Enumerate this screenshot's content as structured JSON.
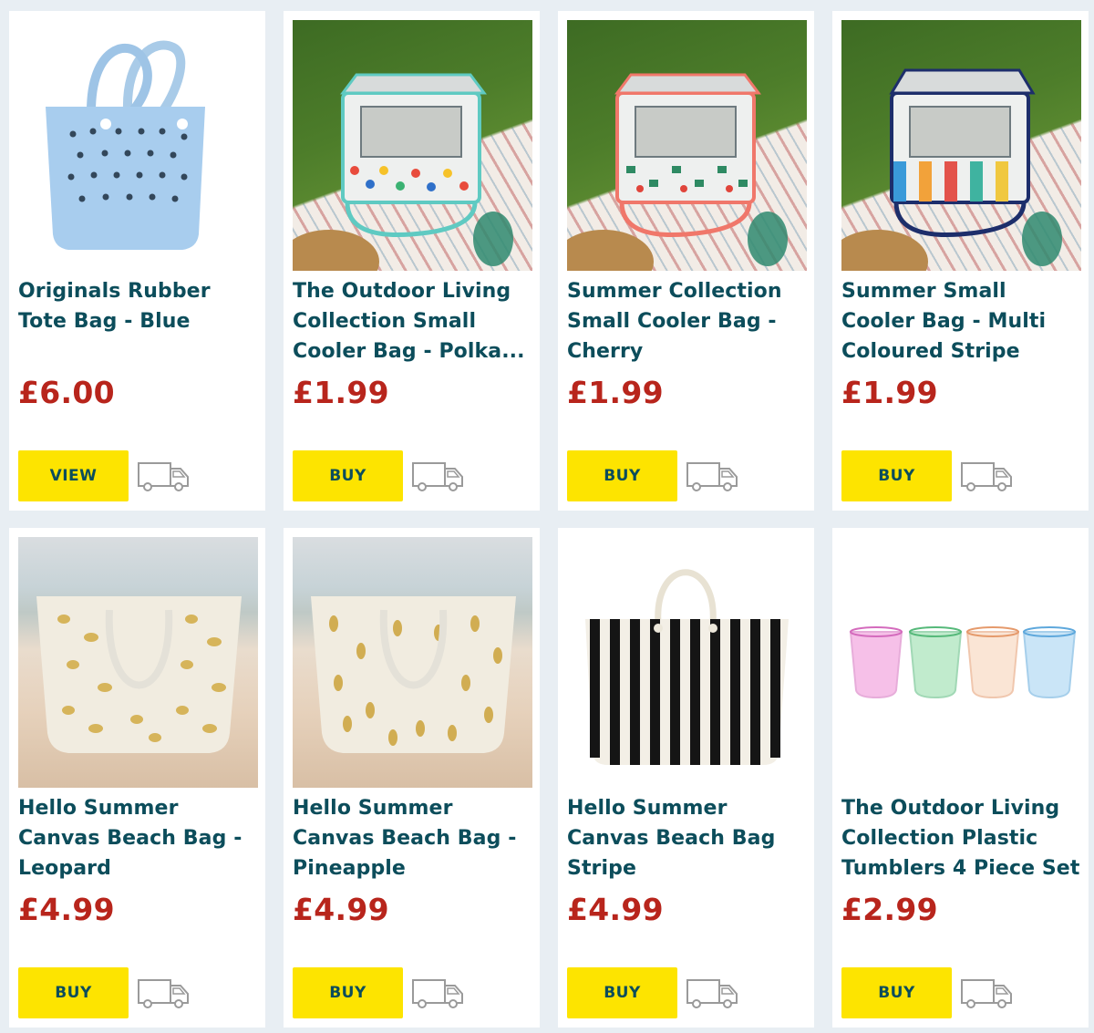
{
  "products": [
    {
      "title": "Originals Rubber Tote Bag - Blue",
      "price": "£6.00",
      "button": "VIEW",
      "image": "blue-rubber-tote-bag"
    },
    {
      "title": "The Outdoor Living Collection Small Cooler Bag - Polka...",
      "price": "£1.99",
      "button": "BUY",
      "image": "polka-cooler-bag"
    },
    {
      "title": "Summer Collection Small Cooler Bag - Cherry",
      "price": "£1.99",
      "button": "BUY",
      "image": "cherry-cooler-bag"
    },
    {
      "title": "Summer Small Cooler Bag - Multi Coloured Stripe",
      "price": "£1.99",
      "button": "BUY",
      "image": "stripe-cooler-bag"
    },
    {
      "title": "Hello Summer Canvas Beach Bag - Leopard",
      "price": "£4.99",
      "button": "BUY",
      "image": "leopard-beach-bag"
    },
    {
      "title": "Hello Summer Canvas Beach Bag - Pineapple",
      "price": "£4.99",
      "button": "BUY",
      "image": "pineapple-beach-bag"
    },
    {
      "title": "Hello Summer Canvas Beach Bag Stripe",
      "price": "£4.99",
      "button": "BUY",
      "image": "stripe-beach-bag"
    },
    {
      "title": "The Outdoor Living Collection Plastic Tumblers 4 Piece Set",
      "price": "£2.99",
      "button": "BUY",
      "image": "plastic-tumblers"
    }
  ],
  "icons": {
    "delivery": "delivery-van-icon"
  },
  "colors": {
    "title": "#0c4d5b",
    "price": "#b8251c",
    "button": "#fde400",
    "background": "#e8eef3"
  }
}
